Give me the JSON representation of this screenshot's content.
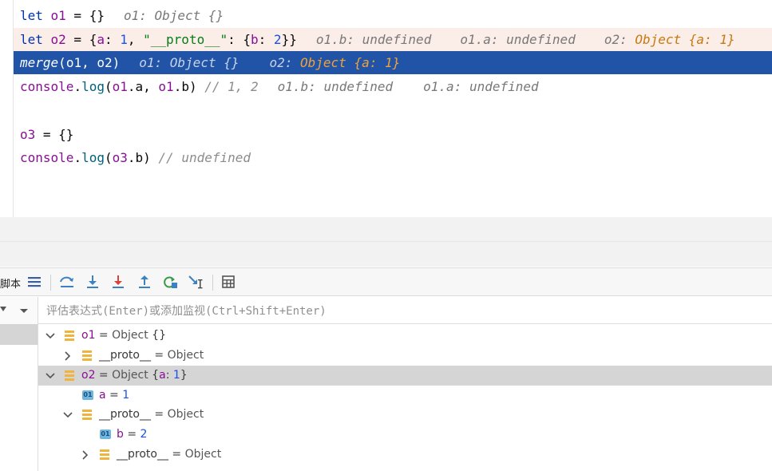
{
  "editor": {
    "line1": {
      "p1": "let ",
      "v1": "o1",
      "p2": " = {}",
      "hint": "o1: Object {}"
    },
    "line2": {
      "p1": "let ",
      "v1": "o2",
      "p2": " = {",
      "k1": "a",
      "p3": ": ",
      "n1": "1",
      "p4": ", ",
      "s1": "\"__proto__\"",
      "p5": ": {",
      "k2": "b",
      "p6": ": ",
      "n2": "2",
      "p7": "}}",
      "hint1": "o1.b: undefined",
      "hint2": "o1.a: undefined",
      "hint3_key": "o2: ",
      "hint3_val": "Object {a: 1}"
    },
    "line3": {
      "fn": "merge",
      "p1": "(",
      "v1": "o1",
      "p2": ", ",
      "v2": "o2",
      "p3": ")",
      "hint1": "o1: Object {}",
      "hint2_key": "o2: ",
      "hint2_val": "Object {a: 1}"
    },
    "line4": {
      "v1": "console",
      "p1": ".",
      "fn": "log",
      "p2": "(",
      "v2": "o1",
      "p3": ".a, ",
      "v3": "o1",
      "p4": ".b) ",
      "comment": "// 1, 2",
      "hint1": "o1.b: undefined",
      "hint2": "o1.a: undefined"
    },
    "line6": {
      "v1": "o3",
      "p1": " = {}"
    },
    "line7": {
      "v1": "console",
      "p1": ".",
      "fn": "log",
      "p2": "(",
      "v2": "o3",
      "p3": ".b) ",
      "comment": "// undefined"
    }
  },
  "toolbar": {
    "partial_label": "脚本",
    "buttons": [
      "list-icon",
      "step-over-icon",
      "step-into-icon",
      "force-step-into-icon",
      "step-out-icon",
      "restart-frame-icon",
      "run-to-cursor-icon",
      "evaluate-icon"
    ]
  },
  "expression": {
    "placeholder": "评估表达式(Enter)或添加监视(Ctrl+Shift+Enter)"
  },
  "variables": [
    {
      "name": "o1",
      "eq": " = ",
      "type": "Object ",
      "value": "{}"
    },
    {
      "name": "__proto__",
      "eq": " = ",
      "type": "Object"
    },
    {
      "name": "o2",
      "eq": " = ",
      "type": "Object ",
      "value_open": "{",
      "value_key": "a",
      "value_sep": ": ",
      "value_num": "1",
      "value_close": "}"
    },
    {
      "name": "a",
      "eq": " = ",
      "num": "1",
      "badge": "01"
    },
    {
      "name": "__proto__",
      "eq": " = ",
      "type": "Object"
    },
    {
      "name": "b",
      "eq": " = ",
      "num": "2",
      "badge": "01"
    },
    {
      "name": "__proto__",
      "eq": " = ",
      "type": "Object"
    }
  ],
  "colors": {
    "exec_line": "#2154a7",
    "hint_orange": "#c77810",
    "pink_line": "#fbede8",
    "selected_row": "#d5d5d5"
  }
}
